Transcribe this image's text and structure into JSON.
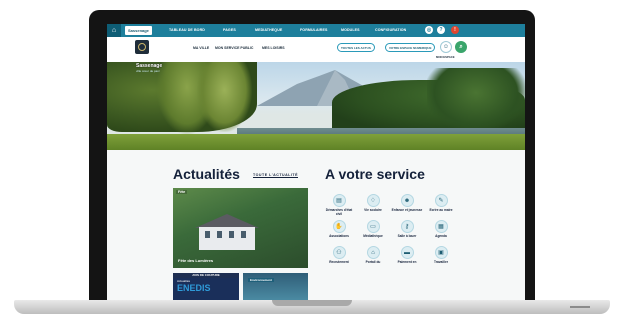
{
  "topnav": {
    "home_icon": "home-icon",
    "city_tab": "Sassenage",
    "items": [
      "TABLEAU DE BORD",
      "PAGES",
      "MEDIATHEQUE",
      "FORMULAIRES",
      "MODULES",
      "CONFIGURATION"
    ],
    "icons": [
      "user-icon",
      "help-icon",
      "notification-icon"
    ]
  },
  "subbar": {
    "nav": [
      "MA VILLE",
      "MON SERVICE PUBLIC",
      "MES LOISIRS"
    ],
    "pills": [
      "TOUTES LES ACTUS",
      "VOTRE ESPACE NUMERIQUE"
    ],
    "connexion_label": "MON ESPACE",
    "accent": "#3aa56b"
  },
  "hero": {
    "city_name": "Sassenage",
    "city_tagline": "ville cœur de parc"
  },
  "actualites": {
    "title": "Actualités",
    "all_link": "TOUTE L'ACTUALITÉ",
    "main_card": {
      "tag": "Fête",
      "caption": "Fête des Lumières"
    },
    "card2": {
      "band": "AVIS DE COUPURE",
      "tag": "Actualités",
      "brand": "ENEDIS"
    },
    "card3": {
      "tag": "Environnement"
    }
  },
  "service": {
    "title": "A votre service",
    "items": [
      {
        "label": "Démarches d'état civil",
        "icon": "document-icon"
      },
      {
        "label": "Vie scolaire",
        "icon": "graduation-icon"
      },
      {
        "label": "Enfance et jeunesse",
        "icon": "baby-icon"
      },
      {
        "label": "Ecrire au maire",
        "icon": "pen-icon"
      },
      {
        "label": "Associations",
        "icon": "handshake-icon"
      },
      {
        "label": "Médiathèque",
        "icon": "book-icon"
      },
      {
        "label": "Salle à louer",
        "icon": "key-icon"
      },
      {
        "label": "Agenda",
        "icon": "calendar-icon"
      },
      {
        "label": "Recrutement",
        "icon": "people-icon"
      },
      {
        "label": "Portail du",
        "icon": "house-icon"
      },
      {
        "label": "Paiement en",
        "icon": "card-icon"
      },
      {
        "label": "Travailler",
        "icon": "briefcase-icon"
      }
    ]
  }
}
